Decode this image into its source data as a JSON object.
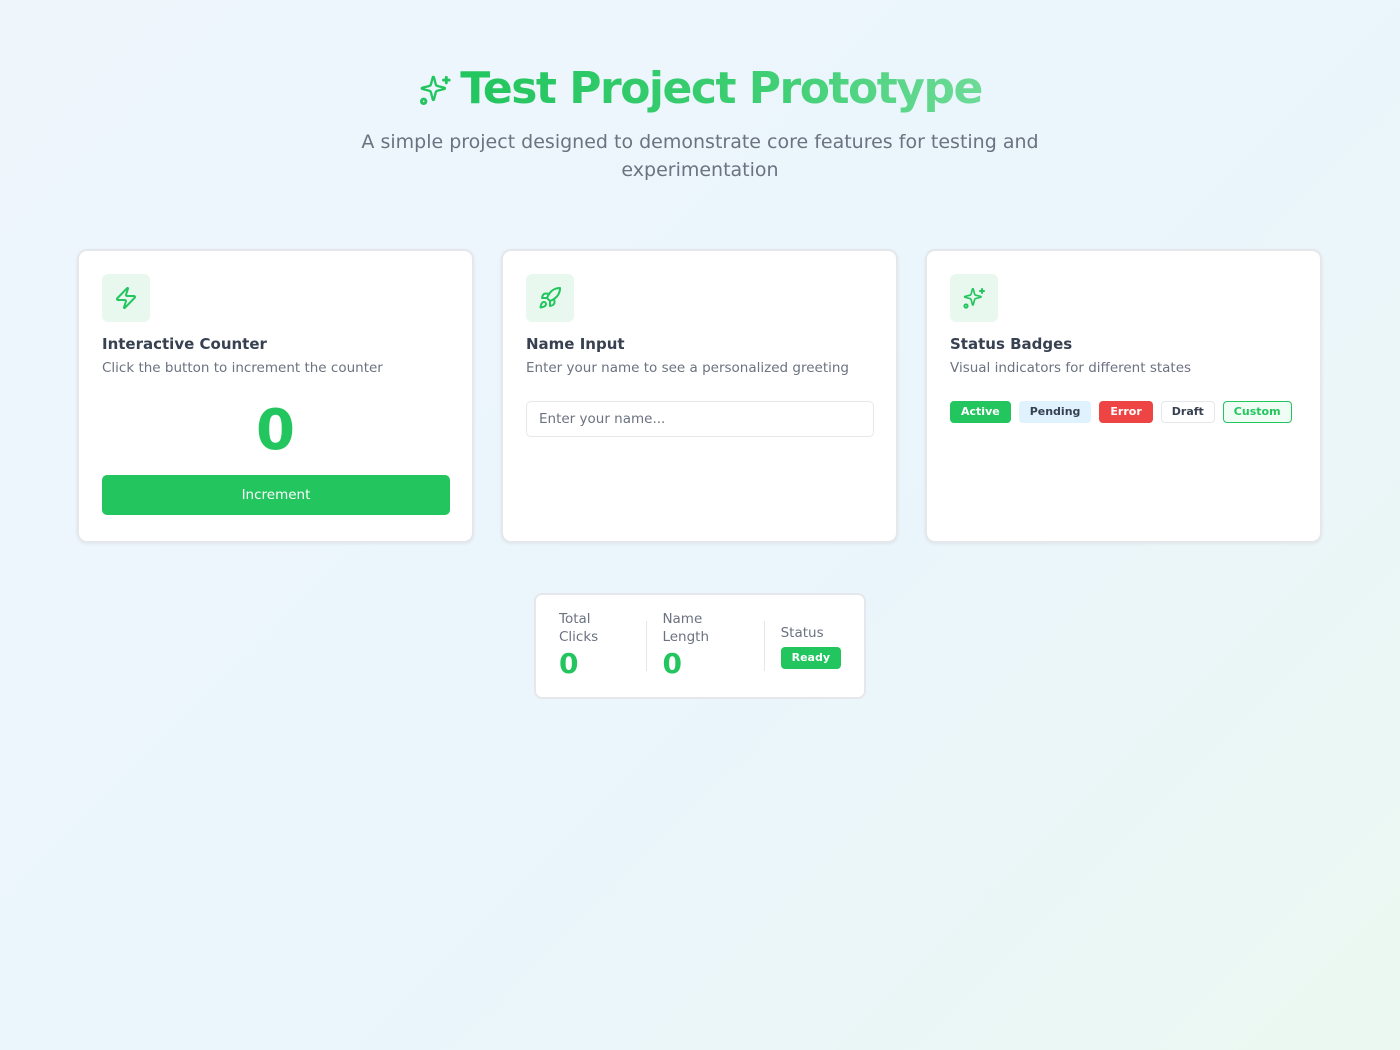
{
  "header": {
    "title": "Test Project Prototype",
    "title_icon": "sparkles-icon",
    "subtitle": "A simple project designed to demonstrate core features for testing and experimentation"
  },
  "cards": {
    "counter": {
      "icon": "lightning-icon",
      "title": "Interactive Counter",
      "description": "Click the button to increment the counter",
      "value": "0",
      "button_label": "Increment"
    },
    "name_input": {
      "icon": "rocket-icon",
      "title": "Name Input",
      "description": "Enter your name to see a personalized greeting",
      "placeholder": "Enter your name...",
      "value": ""
    },
    "badges": {
      "icon": "sparkles-icon",
      "title": "Status Badges",
      "description": "Visual indicators for different states",
      "items": [
        {
          "label": "Active",
          "variant": "active"
        },
        {
          "label": "Pending",
          "variant": "pending"
        },
        {
          "label": "Error",
          "variant": "error"
        },
        {
          "label": "Draft",
          "variant": "draft"
        },
        {
          "label": "Custom",
          "variant": "custom"
        }
      ]
    }
  },
  "stats": {
    "total_clicks_label": "Total Clicks",
    "total_clicks_value": "0",
    "name_length_label": "Name Length",
    "name_length_value": "0",
    "status_label": "Status",
    "status_value": "Ready"
  },
  "colors": {
    "accent": "#22c55e",
    "error": "#ef4444",
    "pending_bg": "#e0f2fe",
    "text_primary": "#374151",
    "text_muted": "#6b7280"
  }
}
